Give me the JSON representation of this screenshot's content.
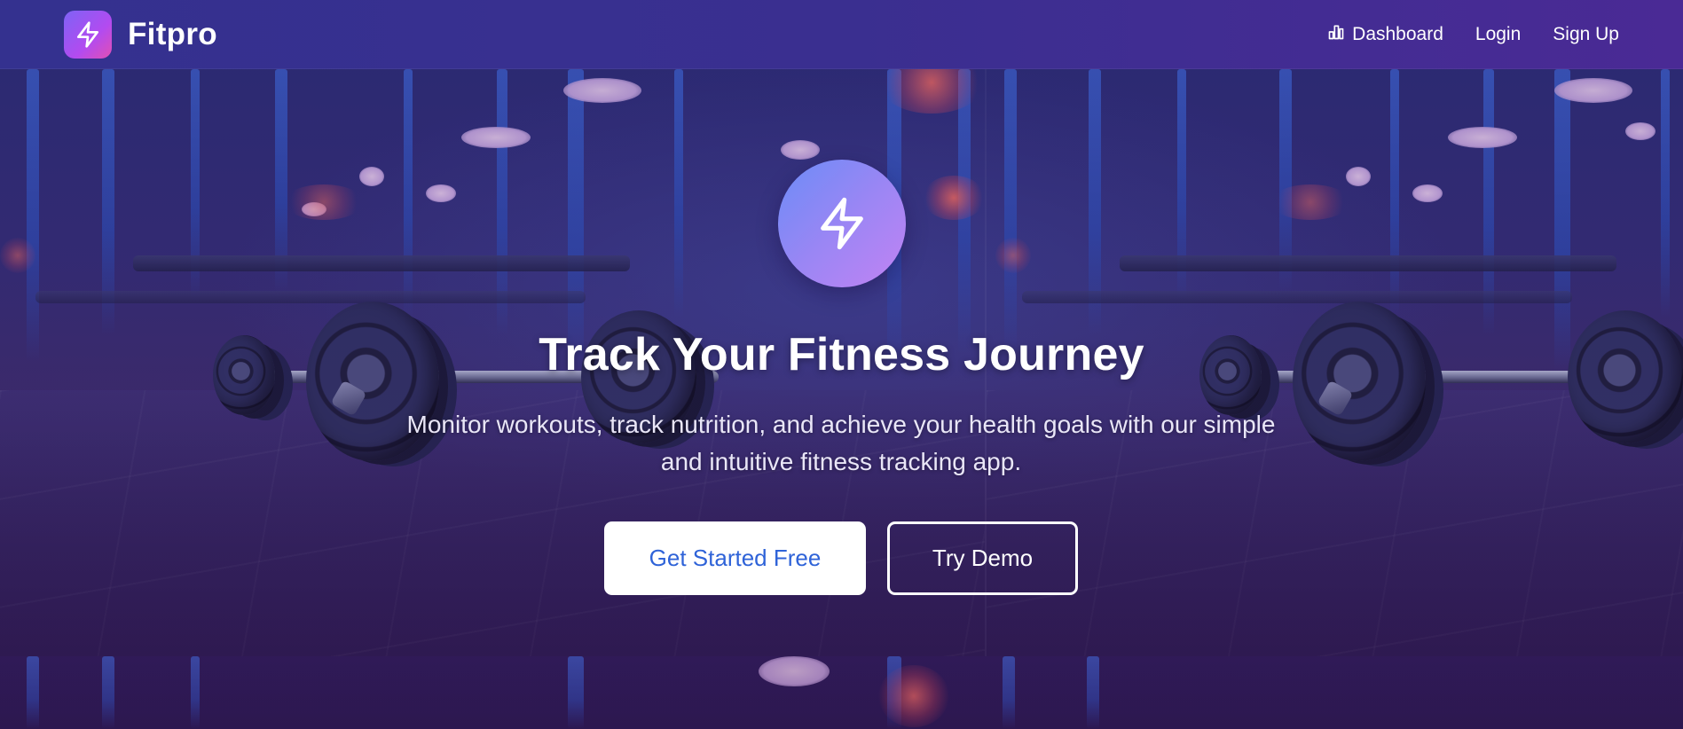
{
  "brand": {
    "name": "Fitpro",
    "logo_icon": "lightning-bolt-icon"
  },
  "nav": {
    "dashboard_label": "Dashboard",
    "dashboard_icon": "bar-chart-icon",
    "login_label": "Login",
    "signup_label": "Sign Up"
  },
  "hero": {
    "icon": "lightning-bolt-icon",
    "title": "Track Your Fitness Journey",
    "subtitle": "Monitor workouts, track nutrition, and achieve your health goals with our simple and intuitive fitness tracking app.",
    "primary_button": "Get Started Free",
    "secondary_button": "Try Demo"
  },
  "colors": {
    "navbar": "#3a2f90",
    "logo_gradient_start": "#7e63f5",
    "logo_gradient_end": "#e24fb4",
    "hero_icon_gradient_start": "#6b8cf7",
    "hero_icon_gradient_end": "#c283f3",
    "primary_button_text": "#2f63d8",
    "primary_button_bg": "#ffffff"
  }
}
